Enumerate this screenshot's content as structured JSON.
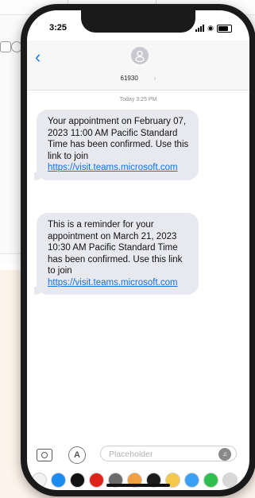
{
  "status_bar": {
    "time": "3:25"
  },
  "header": {
    "contact": "61930",
    "chevron": "›"
  },
  "thread": {
    "timestamp": "Today 3:25 PM",
    "messages": [
      {
        "text": "Your appointment on February 07, 2023 11:00 AM Pacific Standard Time has been confirmed. Use this link to join ",
        "link": "https://visit.teams.microsoft.com"
      },
      {
        "text": "This is a reminder for your appointment on March 21, 2023 10:30 AM Pacific Standard Time has been confirmed. Use this link to join ",
        "link": "https://visit.teams.microsoft.com"
      }
    ]
  },
  "composer": {
    "placeholder": "Placeholder"
  },
  "app_strip": {
    "icons": [
      {
        "name": "photos-app-icon",
        "color": "#f2f2f2"
      },
      {
        "name": "app-store-icon",
        "color": "#1a8cf0"
      },
      {
        "name": "apple-pay-icon",
        "color": "#111111"
      },
      {
        "name": "fitness-app-icon",
        "color": "#e0241b"
      },
      {
        "name": "app-clip-icon",
        "color": "#6b6b6b"
      },
      {
        "name": "memoji-icon",
        "color": "#f0a040"
      },
      {
        "name": "digital-touch-icon",
        "color": "#1c1c1c"
      },
      {
        "name": "animoji-icon",
        "color": "#f4c84a"
      },
      {
        "name": "music-icon",
        "color": "#3aa0f5"
      },
      {
        "name": "find-my-icon",
        "color": "#2fbf4f"
      },
      {
        "name": "more-apps-icon",
        "color": "#d8d8d8"
      }
    ]
  }
}
